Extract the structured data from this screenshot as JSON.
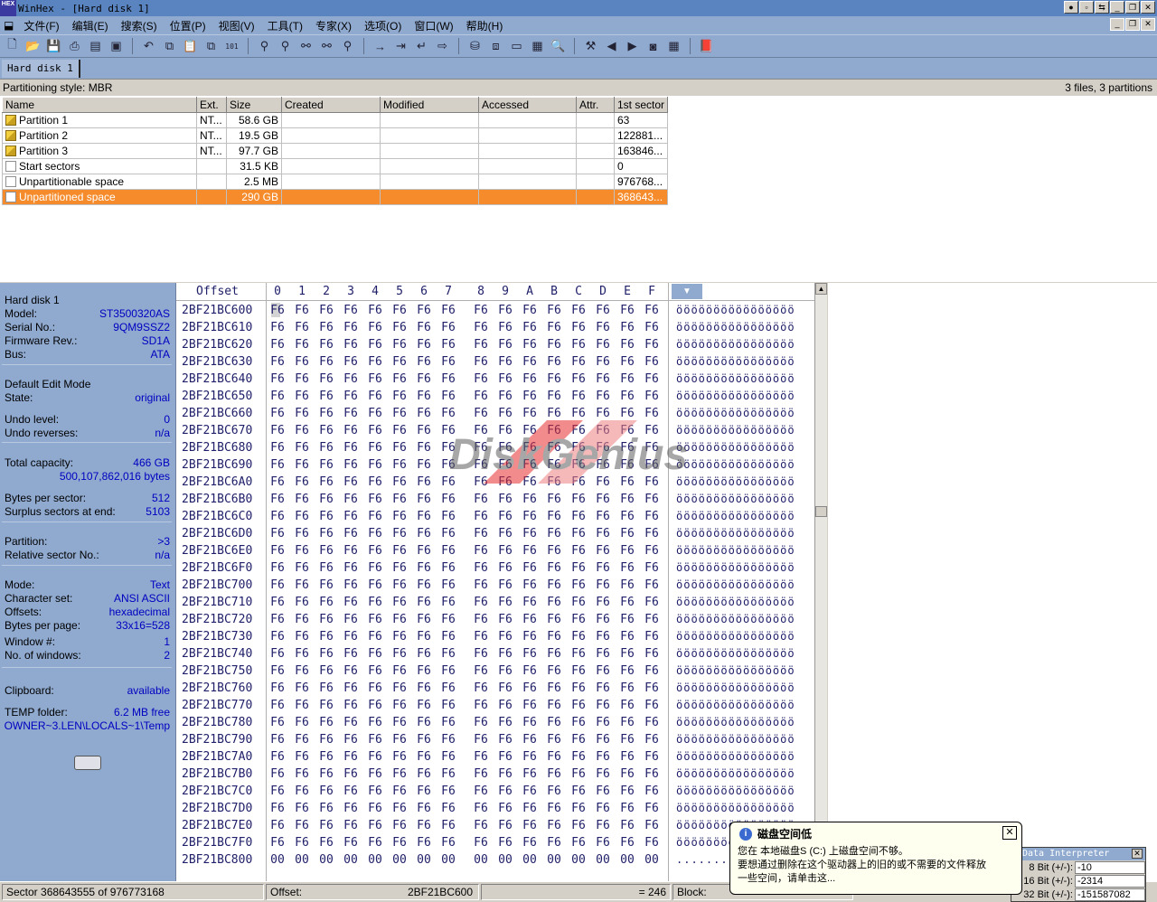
{
  "window": {
    "title": "WinHex - [Hard disk 1]",
    "logo": "HEX"
  },
  "menu": [
    "文件(F)",
    "编辑(E)",
    "搜索(S)",
    "位置(P)",
    "视图(V)",
    "工具(T)",
    "专家(X)",
    "选项(O)",
    "窗口(W)",
    "帮助(H)"
  ],
  "toolbar_icons": [
    "new-file-icon",
    "open-icon",
    "save-icon",
    "print-icon",
    "properties-icon",
    "open-disk-icon",
    "undo-icon",
    "copy-icon",
    "paste-icon",
    "write-icon",
    "convert-icon",
    "find-text-icon",
    "find-hex-icon",
    "replace-text-icon",
    "replace-hex-icon",
    "find-again-icon",
    "goto-offset-icon",
    "goto-sector-icon",
    "back-icon",
    "forward-icon",
    "disk-icon",
    "clone-icon",
    "drive-icon",
    "calculator-icon",
    "zoom-icon",
    "tools-icon",
    "prev-icon",
    "next-icon",
    "camera-icon",
    "table-icon",
    "help-book-icon"
  ],
  "tab": {
    "label": "Hard disk 1"
  },
  "partitions": {
    "style": "Partitioning style: MBR",
    "summary": "3 files, 3 partitions",
    "columns": [
      "Name",
      "Ext.",
      "Size",
      "Created",
      "Modified",
      "Accessed",
      "Attr.",
      "1st sector"
    ],
    "rows": [
      {
        "name": "Partition 1",
        "ext": "NT...",
        "size": "58.6 GB",
        "first": "63",
        "icon": "partition"
      },
      {
        "name": "Partition 2",
        "ext": "NT...",
        "size": "19.5 GB",
        "first": "122881...",
        "icon": "partition"
      },
      {
        "name": "Partition 3",
        "ext": "NT...",
        "size": "97.7 GB",
        "first": "163846...",
        "icon": "partition"
      },
      {
        "name": "Start sectors",
        "ext": "",
        "size": "31.5 KB",
        "first": "0",
        "icon": "doc"
      },
      {
        "name": "Unpartitionable space",
        "ext": "",
        "size": "2.5 MB",
        "first": "976768...",
        "icon": "doc"
      },
      {
        "name": "Unpartitioned space",
        "ext": "",
        "size": "290 GB",
        "first": "368643...",
        "icon": "doc",
        "selected": true
      }
    ]
  },
  "info": {
    "disk": "Hard disk 1",
    "model_k": "Model:",
    "model": "ST3500320AS",
    "serial_k": "Serial No.:",
    "serial": "9QM9SSZ2",
    "fw_k": "Firmware Rev.:",
    "fw": "SD1A",
    "bus_k": "Bus:",
    "bus": "ATA",
    "edit_mode": "Default Edit Mode",
    "state_k": "State:",
    "state": "original",
    "undo_k": "Undo level:",
    "undo": "0",
    "undorev_k": "Undo reverses:",
    "undorev": "n/a",
    "cap_k": "Total capacity:",
    "cap": "466 GB",
    "cap_bytes": "500,107,862,016 bytes",
    "bps_k": "Bytes per sector:",
    "bps": "512",
    "surplus_k": "Surplus sectors at end:",
    "surplus": "5103",
    "part_k": "Partition:",
    "part": ">3",
    "rel_k": "Relative sector No.:",
    "rel": "n/a",
    "mode_k": "Mode:",
    "mode": "Text",
    "charset_k": "Character set:",
    "charset": "ANSI ASCII",
    "offsets_k": "Offsets:",
    "offsets": "hexadecimal",
    "bpp_k": "Bytes per page:",
    "bpp": "33x16=528",
    "win_k": "Window #:",
    "win": "1",
    "nwin_k": "No. of windows:",
    "nwin": "2",
    "clip_k": "Clipboard:",
    "clip": "available",
    "temp_k": "TEMP folder:",
    "temp": "6.2 MB free",
    "temp_path": "OWNER~3.LEN\\LOCALS~1\\Temp"
  },
  "hex": {
    "offset_label": "Offset",
    "columns": [
      "0",
      "1",
      "2",
      "3",
      "4",
      "5",
      "6",
      "7",
      "8",
      "9",
      "A",
      "B",
      "C",
      "D",
      "E",
      "F"
    ],
    "rows": [
      {
        "off": "2BF21BC600",
        "b": "F6",
        "a": "öööööööööööööööö"
      },
      {
        "off": "2BF21BC610",
        "b": "F6",
        "a": "öööööööööööööööö"
      },
      {
        "off": "2BF21BC620",
        "b": "F6",
        "a": "öööööööööööööööö"
      },
      {
        "off": "2BF21BC630",
        "b": "F6",
        "a": "öööööööööööööööö"
      },
      {
        "off": "2BF21BC640",
        "b": "F6",
        "a": "öööööööööööööööö"
      },
      {
        "off": "2BF21BC650",
        "b": "F6",
        "a": "öööööööööööööööö"
      },
      {
        "off": "2BF21BC660",
        "b": "F6",
        "a": "öööööööööööööööö"
      },
      {
        "off": "2BF21BC670",
        "b": "F6",
        "a": "öööööööööööööööö"
      },
      {
        "off": "2BF21BC680",
        "b": "F6",
        "a": "öööööööööööööööö"
      },
      {
        "off": "2BF21BC690",
        "b": "F6",
        "a": "öööööööööööööööö"
      },
      {
        "off": "2BF21BC6A0",
        "b": "F6",
        "a": "öööööööööööööööö"
      },
      {
        "off": "2BF21BC6B0",
        "b": "F6",
        "a": "öööööööööööööööö"
      },
      {
        "off": "2BF21BC6C0",
        "b": "F6",
        "a": "öööööööööööööööö"
      },
      {
        "off": "2BF21BC6D0",
        "b": "F6",
        "a": "öööööööööööööööö"
      },
      {
        "off": "2BF21BC6E0",
        "b": "F6",
        "a": "öööööööööööööööö"
      },
      {
        "off": "2BF21BC6F0",
        "b": "F6",
        "a": "öööööööööööööööö"
      },
      {
        "off": "2BF21BC700",
        "b": "F6",
        "a": "öööööööööööööööö"
      },
      {
        "off": "2BF21BC710",
        "b": "F6",
        "a": "öööööööööööööööö"
      },
      {
        "off": "2BF21BC720",
        "b": "F6",
        "a": "öööööööööööööööö"
      },
      {
        "off": "2BF21BC730",
        "b": "F6",
        "a": "öööööööööööööööö"
      },
      {
        "off": "2BF21BC740",
        "b": "F6",
        "a": "öööööööööööööööö"
      },
      {
        "off": "2BF21BC750",
        "b": "F6",
        "a": "öööööööööööööööö"
      },
      {
        "off": "2BF21BC760",
        "b": "F6",
        "a": "öööööööööööööööö"
      },
      {
        "off": "2BF21BC770",
        "b": "F6",
        "a": "öööööööööööööööö"
      },
      {
        "off": "2BF21BC780",
        "b": "F6",
        "a": "öööööööööööööööö"
      },
      {
        "off": "2BF21BC790",
        "b": "F6",
        "a": "öööööööööööööööö"
      },
      {
        "off": "2BF21BC7A0",
        "b": "F6",
        "a": "öööööööööööööööö"
      },
      {
        "off": "2BF21BC7B0",
        "b": "F6",
        "a": "öööööööööööööööö"
      },
      {
        "off": "2BF21BC7C0",
        "b": "F6",
        "a": "öööööööööööööööö"
      },
      {
        "off": "2BF21BC7D0",
        "b": "F6",
        "a": "öööööööööööööööö"
      },
      {
        "off": "2BF21BC7E0",
        "b": "F6",
        "a": "öööööööööööööööö"
      },
      {
        "off": "2BF21BC7F0",
        "b": "F6",
        "a": "öööööööööööööööö"
      },
      {
        "off": "2BF21BC800",
        "b": "00",
        "a": "................"
      }
    ]
  },
  "status": {
    "sector": "Sector 368643555 of 976773168",
    "offset_k": "Offset:",
    "offset": "2BF21BC600",
    "value": "= 246",
    "block_k": "Block:"
  },
  "balloon": {
    "title": "磁盘空间低",
    "line1": "您在 本地磁盘S (C:) 上磁盘空间不够。",
    "line2": "要想通过删除在这个驱动器上的旧的或不需要的文件释放",
    "line3": "一些空间，请单击这..."
  },
  "interpreter": {
    "title": "Data Interpreter",
    "rows": [
      {
        "k": "8 Bit (+/-):",
        "v": "-10"
      },
      {
        "k": "16 Bit (+/-):",
        "v": "-2314"
      },
      {
        "k": "32 Bit (+/-):",
        "v": "-151587082"
      }
    ]
  },
  "watermark": "DiskGenius",
  "colors": {
    "accent": "#8fa9cf",
    "selection": "#f58b2a",
    "value_text": "#0000c0"
  }
}
